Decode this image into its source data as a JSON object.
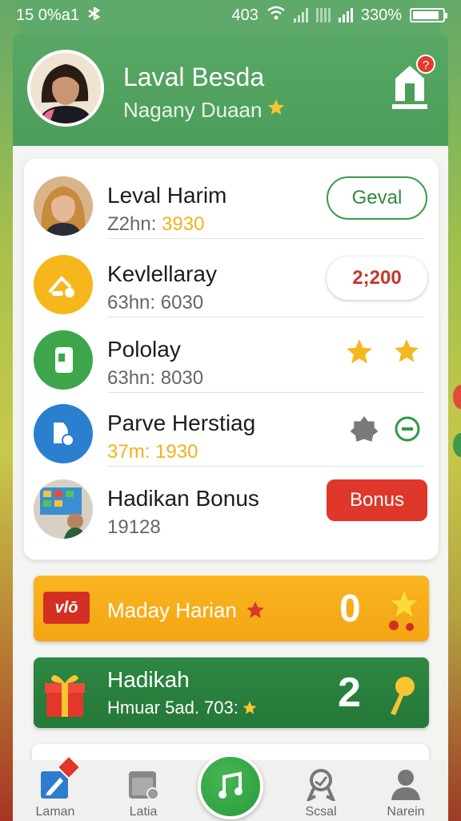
{
  "status_bar": {
    "left_text": "15 0%a1",
    "right_text": "403",
    "battery_text": "330%"
  },
  "header": {
    "title": "Laval Besda",
    "subtitle": "Nagany Duaan",
    "notification_count": "?",
    "home_icon": "home-icon"
  },
  "list": [
    {
      "title": "Leval Harim",
      "sub_prefix": "Z2hn: ",
      "sub_value": "3930",
      "action": {
        "type": "button",
        "label": "Geval"
      }
    },
    {
      "title": "Kevlellaray",
      "sub_prefix": "63hn: ",
      "sub_value": "6030",
      "action": {
        "type": "pill",
        "label": "2;200"
      }
    },
    {
      "title": "Pololay",
      "sub_prefix": "63hn: ",
      "sub_value": "8030",
      "action": {
        "type": "stars"
      }
    },
    {
      "title": "Parve Herstiag",
      "sub_prefix": "",
      "sub_value": "37m: 1930",
      "action": {
        "type": "toggle-icons"
      }
    },
    {
      "title": "Hadikan Bonus",
      "sub_prefix": "",
      "sub_value": "19128",
      "action": {
        "type": "button",
        "label": "Bonus"
      }
    }
  ],
  "banner_daily": {
    "badge": "vlō",
    "label": "Maday Harian",
    "count": "0"
  },
  "banner_gift": {
    "title": "Hadikah",
    "subtitle": "Hmuar 5ad. 703:",
    "count": "2"
  },
  "bottom_nav": [
    {
      "label": "Laman",
      "icon": "edit-icon"
    },
    {
      "label": "Latia",
      "icon": "calendar-icon"
    },
    {
      "label": "",
      "icon": "music-icon"
    },
    {
      "label": "Scsal",
      "icon": "medal-icon"
    },
    {
      "label": "Narein",
      "icon": "user-icon"
    }
  ],
  "colors": {
    "header_green": "#4c9d5a",
    "accent_yellow": "#f4a514",
    "accent_red": "#e0372b",
    "dark_green": "#257838"
  }
}
